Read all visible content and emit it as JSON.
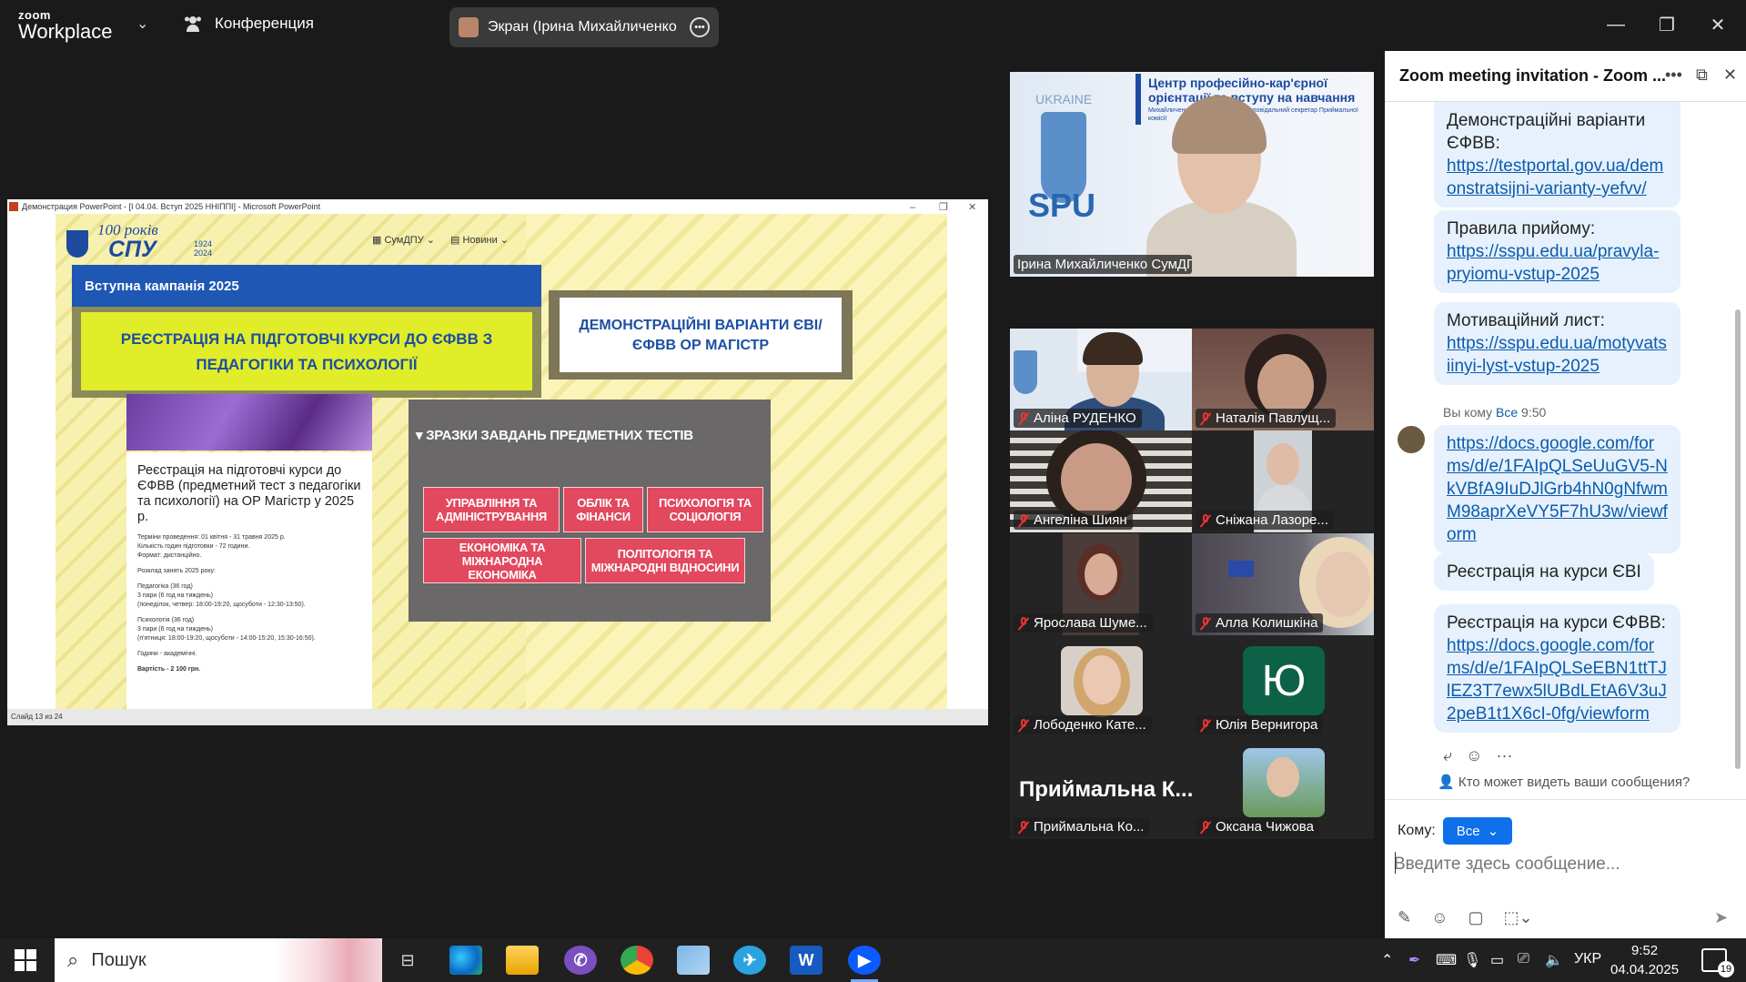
{
  "app": {
    "logo_top": "zoom",
    "logo_bottom": "Workplace",
    "conference_label": "Конференция",
    "screen_share_label": "Экран (Ірина Михайличенко СумДПУ"
  },
  "share": {
    "window_title": "Демонстрация PowerPoint - [І 04.04. Вступ 2025 ННІППІ] - Microsoft PowerPoint",
    "status_left": "Слайд 13 из 24",
    "slide": {
      "logo_years_label": "100 років",
      "logo_spu": "СПУ",
      "logo_years": "1924 2024",
      "nav_1": "СумДПУ",
      "nav_2": "Новини",
      "banner": "Вступна кампанія 2025",
      "yellow_box": "РЕЄСТРАЦІЯ НА ПІДГОТОВЧІ КУРСИ ДО ЄФВВ З ПЕДАГОГІКИ ТА ПСИХОЛОГІЇ",
      "demo_box": "ДЕМОНСТРАЦІЙНІ ВАРІАНТИ ЄВІ/ЄФВВ ОР МАГІСТР",
      "reg_heading": "Реєстрація на підготовчі курси до ЄФВВ (предметний тест з педагогіки та психології) на ОР Магістр у 2025 р.",
      "reg_lines": [
        "Терміни проведення: 01 квітня - 31 травня 2025 р.",
        "Кількість годин підготовки - 72 години.",
        "Формат: дистанційно.",
        "Розклад занять 2025 року:",
        "Педагогіка (36 год)",
        "3 пари (6 год на тиждень)",
        "(понеділок, четвер: 18:00-19:20, щосуботи - 12:30-13:50).",
        "Психологія (36 год)",
        "3 пари (6 год на тиждень)",
        "(п'ятниця: 18:00-19:20, щосуботи - 14:00-15:20, 15:30-16:50).",
        "Години - академічні.",
        "Вартість - 2 100 грн."
      ],
      "grey_heading": "ЗРАЗКИ ЗАВДАНЬ ПРЕДМЕТНИХ ТЕСТІВ",
      "buttons": [
        "УПРАВЛІННЯ ТА АДМІНІСТРУВАННЯ",
        "ОБЛІК ТА ФІНАНСИ",
        "ПСИХОЛОГІЯ ТА СОЦІОЛОГІЯ",
        "ЕКОНОМІКА ТА МІЖНАРОДНА ЕКОНОМІКА",
        "ПОЛІТОЛОГІЯ ТА МІЖНАРОДНІ ВІДНОСИНИ"
      ]
    }
  },
  "speaker": {
    "name": "Ірина Михайличенко СумДПУ імені А. С. ...",
    "bg_title": "Центр професійно-кар'єрної орієнтації та вступу на навчання",
    "bg_sub": "Михайличенко Ірина Сергіївна - відповідальний секретар Приймальної комісії",
    "bg_ukraine": "UKRAINE",
    "bg_spu": "SPU"
  },
  "participants": [
    {
      "name": "Аліна РУДЕНКО"
    },
    {
      "name": "Наталія Павлущ..."
    },
    {
      "name": "Ангеліна Шиян"
    },
    {
      "name": "Сніжана Лазоре..."
    },
    {
      "name": "Ярослава Шуме..."
    },
    {
      "name": "Алла Колишкіна"
    },
    {
      "name": "Лободенко Кате..."
    },
    {
      "name": "Юлія Вернигора",
      "initial": "Ю"
    },
    {
      "name": "Приймальна Ко...",
      "big_label": "Приймальна К..."
    },
    {
      "name": "Оксана Чижова"
    }
  ],
  "chat": {
    "title": "Zoom meeting invitation - Zoom ...",
    "messages": [
      {
        "text": "Демонстраційні варіанти ЄФВВ:",
        "link": "https://testportal.gov.ua/demonstratsijni-varianty-yefvv/"
      },
      {
        "text": "Правила прийому:",
        "link": "https://sspu.edu.ua/pravyla-pryiomu-vstup-2025"
      },
      {
        "text": "Мотиваційний лист:",
        "link": "https://sspu.edu.ua/motyvatsiinyi-lyst-vstup-2025"
      },
      {
        "link": "https://docs.google.com/forms/d/e/1FAIpQLSeUuGV5-NkVBfA9IuDJlGrb4hN0gNfwmM98aprXeVY5F7hU3w/viewform"
      },
      {
        "text": "Реєстрація на курси ЄВІ"
      },
      {
        "text": "Реєстрація на курси ЄФВВ:",
        "link": "https://docs.google.com/forms/d/e/1FAIpQLSeEBN1ttTJlEZ3T7ewx5lUBdLEtA6V3uJ2peB1t1X6cI-0fg/viewform"
      }
    ],
    "meta_sender": "Вы кому",
    "meta_to": "Все",
    "meta_time": "9:50",
    "who_can_see": "Кто может видеть ваши сообщения?",
    "to_label": "Кому:",
    "to_value": "Все",
    "input_placeholder": "Введите здесь сообщение..."
  },
  "taskbar": {
    "search_label": "Пошук",
    "language": "УКР",
    "time": "9:52",
    "date": "04.04.2025",
    "notifications": "19"
  },
  "colors": {
    "accent": "#0e71eb",
    "bubble": "#e6f1fd",
    "link": "#0b5cad",
    "slide_banner": "#1f57b5",
    "slide_pink": "#e2485e"
  }
}
